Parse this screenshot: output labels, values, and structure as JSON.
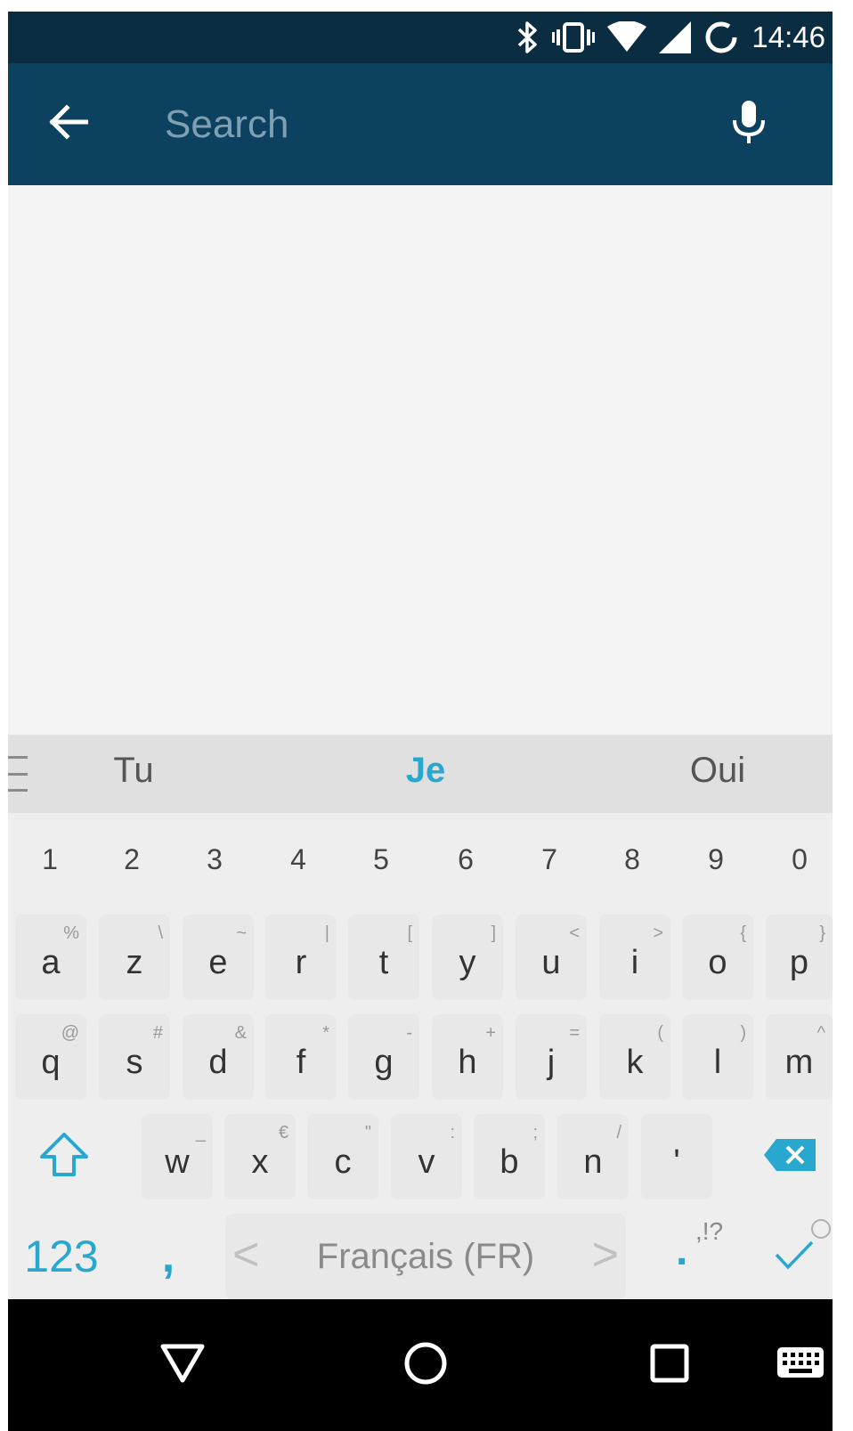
{
  "status_bar": {
    "time": "14:46"
  },
  "search": {
    "placeholder": "Search",
    "value": ""
  },
  "suggestions": {
    "left": "Tu",
    "middle": "Je",
    "right": "Oui"
  },
  "number_row": [
    "1",
    "2",
    "3",
    "4",
    "5",
    "6",
    "7",
    "8",
    "9",
    "0"
  ],
  "row1": [
    {
      "ch": "a",
      "sub": "%"
    },
    {
      "ch": "z",
      "sub": "\\"
    },
    {
      "ch": "e",
      "sub": "~"
    },
    {
      "ch": "r",
      "sub": "|"
    },
    {
      "ch": "t",
      "sub": "["
    },
    {
      "ch": "y",
      "sub": "]"
    },
    {
      "ch": "u",
      "sub": "<"
    },
    {
      "ch": "i",
      "sub": ">"
    },
    {
      "ch": "o",
      "sub": "{"
    },
    {
      "ch": "p",
      "sub": "}"
    }
  ],
  "row2": [
    {
      "ch": "q",
      "sub": "@"
    },
    {
      "ch": "s",
      "sub": "#"
    },
    {
      "ch": "d",
      "sub": "&"
    },
    {
      "ch": "f",
      "sub": "*"
    },
    {
      "ch": "g",
      "sub": "-"
    },
    {
      "ch": "h",
      "sub": "+"
    },
    {
      "ch": "j",
      "sub": "="
    },
    {
      "ch": "k",
      "sub": "("
    },
    {
      "ch": "l",
      "sub": ")"
    },
    {
      "ch": "m",
      "sub": "^"
    }
  ],
  "row3": [
    {
      "ch": "w",
      "sub": "_"
    },
    {
      "ch": "x",
      "sub": "€"
    },
    {
      "ch": "c",
      "sub": "\""
    },
    {
      "ch": "v",
      "sub": ":"
    },
    {
      "ch": "b",
      "sub": ";"
    },
    {
      "ch": "n",
      "sub": "/"
    },
    {
      "ch": "'",
      "sub": ""
    }
  ],
  "bottom_row": {
    "symbols_label": "123",
    "comma": ",",
    "space_label": "Français (FR)",
    "left_arrow": "<",
    "right_arrow": ">",
    "period": ".",
    "punct_alt": ",!?"
  },
  "colors": {
    "accent": "#28a8cf",
    "appbar": "#0c425f",
    "statusbar": "#0b2d42"
  },
  "icons": [
    "back-arrow-icon",
    "mic-icon",
    "bluetooth-icon",
    "vibrate-icon",
    "wifi-icon",
    "signal-icon",
    "sync-icon",
    "shift-icon",
    "backspace-icon",
    "checkmark-icon",
    "nav-back-icon",
    "nav-home-icon",
    "nav-recents-icon",
    "keyboard-icon"
  ]
}
